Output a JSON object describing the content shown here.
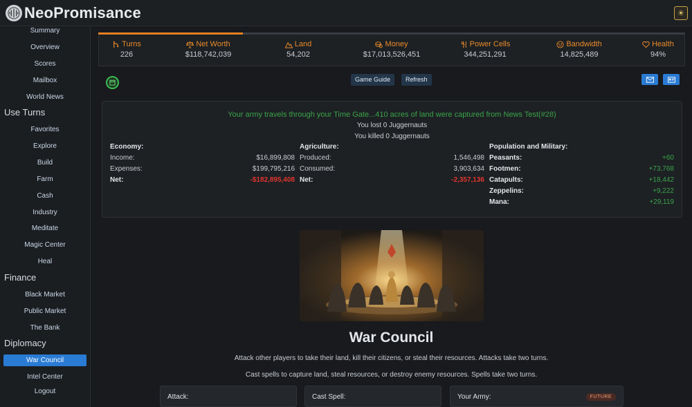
{
  "app": {
    "brand": "NeoPromisance"
  },
  "sidebar": {
    "items_top": [
      {
        "label": "Summary"
      },
      {
        "label": "Overview"
      },
      {
        "label": "Scores"
      },
      {
        "label": "Mailbox"
      },
      {
        "label": "World News"
      }
    ],
    "use_turns": {
      "heading": "Use Turns",
      "items": [
        {
          "label": "Favorites"
        },
        {
          "label": "Explore"
        },
        {
          "label": "Build"
        },
        {
          "label": "Farm"
        },
        {
          "label": "Cash"
        },
        {
          "label": "Industry"
        },
        {
          "label": "Meditate"
        },
        {
          "label": "Magic Center"
        },
        {
          "label": "Heal"
        }
      ]
    },
    "finance": {
      "heading": "Finance",
      "items": [
        {
          "label": "Black Market"
        },
        {
          "label": "Public Market"
        },
        {
          "label": "The Bank"
        }
      ]
    },
    "diplomacy": {
      "heading": "Diplomacy",
      "items": [
        {
          "label": "War Council",
          "active": true
        },
        {
          "label": "Intel Center"
        }
      ]
    },
    "logout": "Logout"
  },
  "resources": [
    {
      "label": "Turns",
      "value": "226",
      "icon": "turns-icon"
    },
    {
      "label": "Net Worth",
      "value": "$118,742,039",
      "icon": "scale-icon"
    },
    {
      "label": "Land",
      "value": "54,202",
      "icon": "mountain-icon"
    },
    {
      "label": "Money",
      "value": "$17,013,526,451",
      "icon": "coins-icon"
    },
    {
      "label": "Power Cells",
      "value": "344,251,291",
      "icon": "power-icon"
    },
    {
      "label": "Bandwidth",
      "value": "14,825,489",
      "icon": "bandwidth-icon"
    },
    {
      "label": "Health",
      "value": "94%",
      "icon": "heart-icon"
    }
  ],
  "toolbar": {
    "guide": "Game Guide",
    "refresh": "Refresh"
  },
  "report": {
    "headline": "Your army travels through your Time Gate...410 acres of land were captured from News Test(#28)",
    "lost": "You lost 0 Juggernauts",
    "killed": "You killed 0 Juggernauts",
    "economy": {
      "title": "Economy:",
      "income_k": "Income:",
      "income_v": "$16,899,808",
      "expenses_k": "Expenses:",
      "expenses_v": "$199,795,216",
      "net_k": "Net:",
      "net_v": "-$182,895,408"
    },
    "agriculture": {
      "title": "Agriculture:",
      "produced_k": "Produced:",
      "produced_v": "1,546,498",
      "consumed_k": "Consumed:",
      "consumed_v": "3,903,634",
      "net_k": "Net:",
      "net_v": "-2,357,136"
    },
    "population": {
      "title": "Population and Military:",
      "peasants_k": "Peasants:",
      "peasants_v": "+60",
      "footmen_k": "Footmen:",
      "footmen_v": "+73,768",
      "catapults_k": "Catapults:",
      "catapults_v": "+18,442",
      "zeppelins_k": "Zeppelins:",
      "zeppelins_v": "+9,222",
      "mana_k": "Mana:",
      "mana_v": "+29,119"
    }
  },
  "council": {
    "title": "War Council",
    "line1": "Attack other players to take their land, kill their citizens, or steal their resources. Attacks take two turns.",
    "line2": "Cast spells to capture land, steal resources, or destroy enemy resources. Spells take two turns.",
    "cards": {
      "attack": "Attack:",
      "spell": "Cast Spell:",
      "army": "Your Army:",
      "army_badge": "FUTURE"
    }
  },
  "colors": {
    "accent_orange": "#e67e22",
    "active_blue": "#2a7bd3",
    "positive_green": "#3aa34a",
    "negative_red": "#e0342f"
  }
}
